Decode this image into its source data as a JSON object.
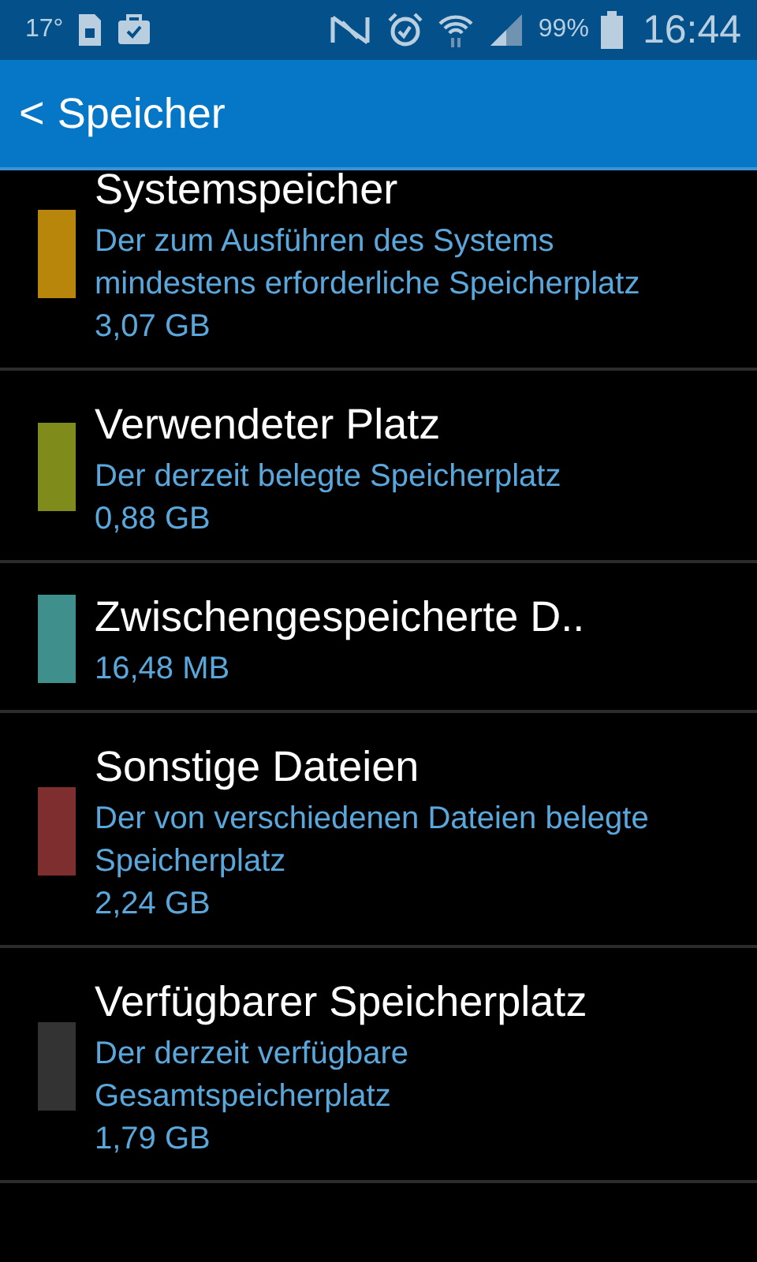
{
  "status_bar": {
    "temperature": "17°",
    "battery": "99%",
    "time": "16:44"
  },
  "header": {
    "back": "<",
    "title": "Speicher"
  },
  "items": [
    {
      "title": "Systemspeicher",
      "description": "Der zum Ausführen des Systems mindestens erforderliche Speicherplatz",
      "size": "3,07 GB",
      "color": "#b8860b"
    },
    {
      "title": "Verwendeter Platz",
      "description": "Der derzeit belegte Speicherplatz",
      "size": "0,88 GB",
      "color": "#7f8c1b"
    },
    {
      "title": "Zwischengespeicherte D..",
      "size": "16,48 MB",
      "color": "#3f8f8c"
    },
    {
      "title": "Sonstige Dateien",
      "description": "Der von verschiedenen Dateien belegte Speicherplatz",
      "size": "2,24 GB",
      "color": "#7f2e30"
    },
    {
      "title": "Verfügbarer Speicherplatz",
      "description": "Der derzeit verfügbare Gesamtspeicherplatz",
      "size": "1,79 GB",
      "color": "#333333"
    }
  ]
}
